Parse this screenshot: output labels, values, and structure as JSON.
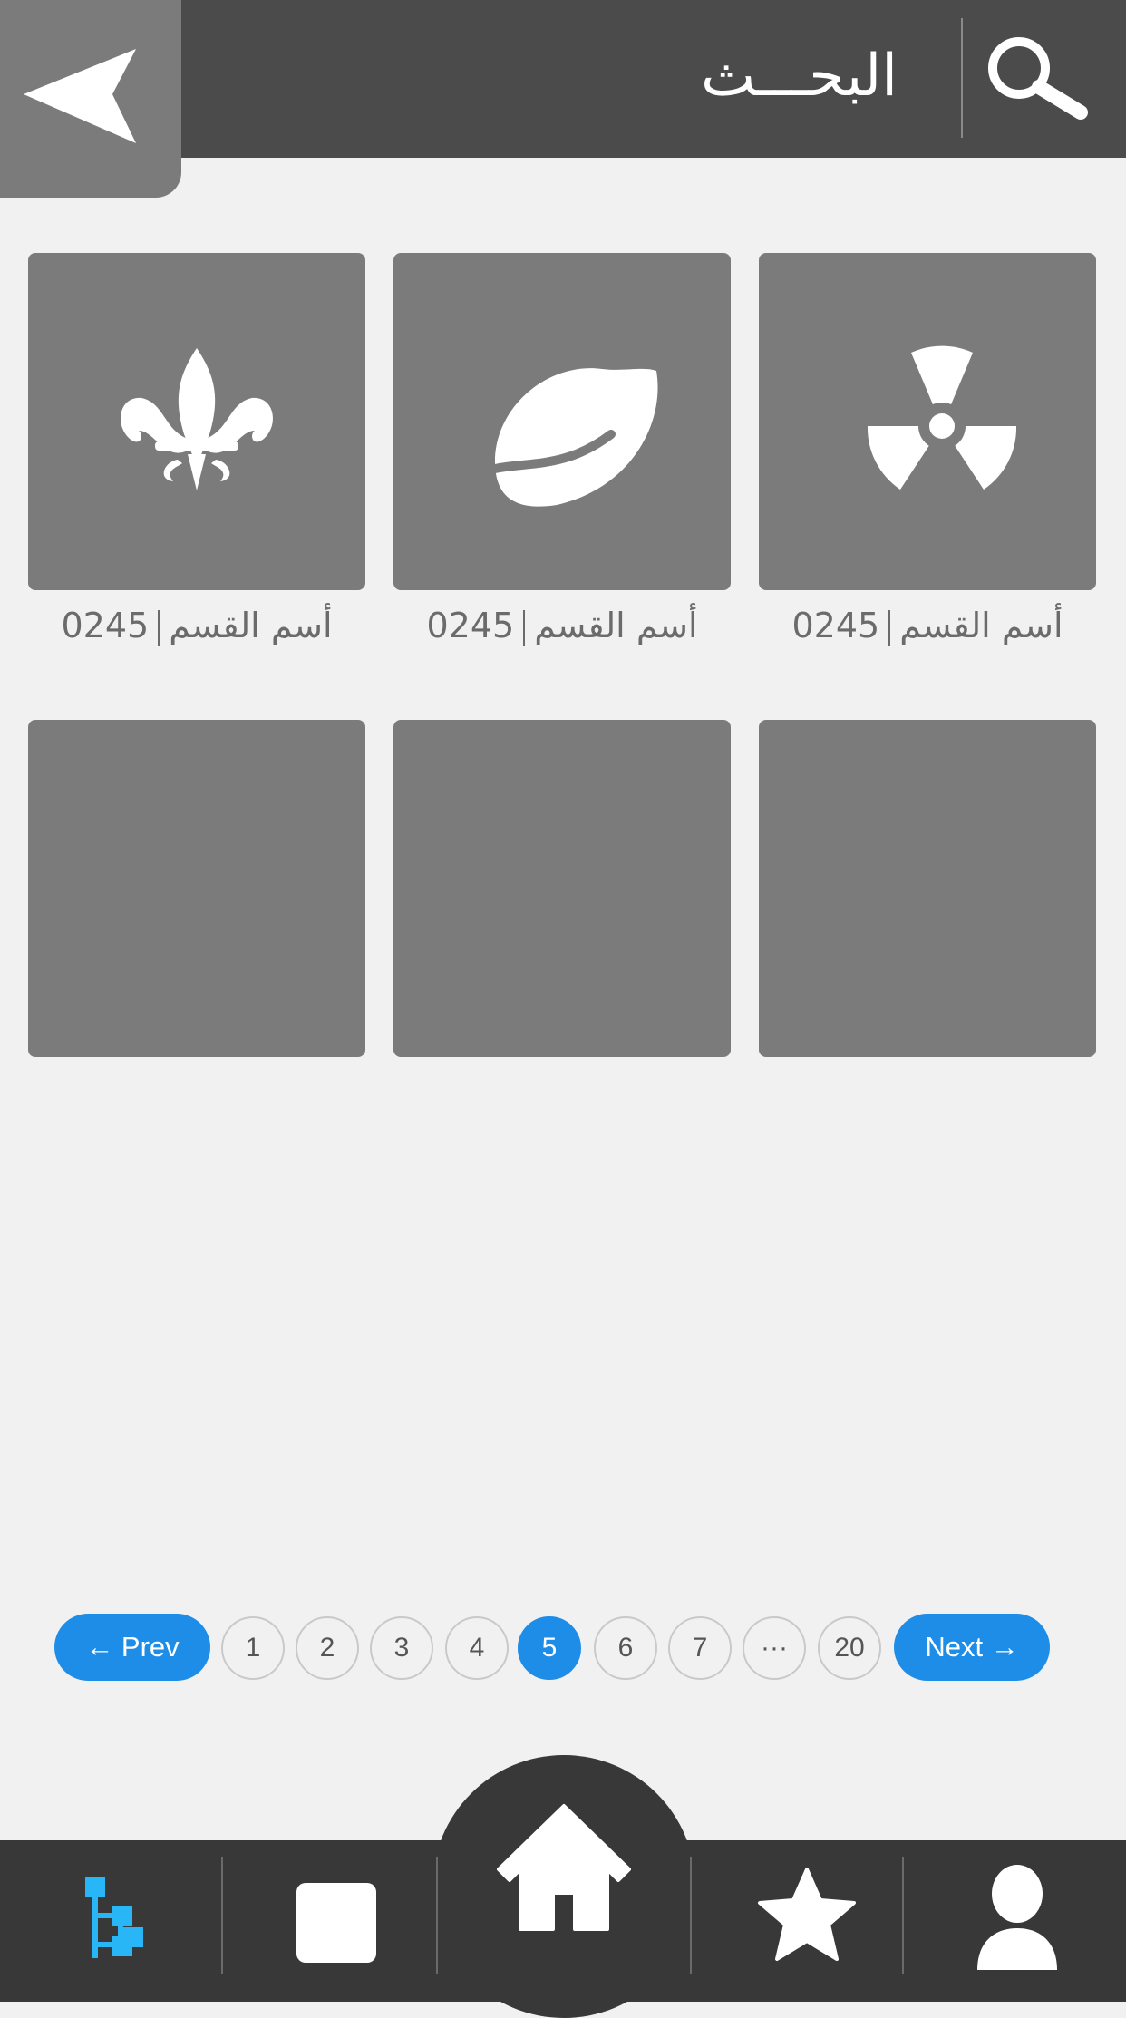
{
  "header": {
    "title": "البحـــث",
    "back_icon": "back-arrow-icon",
    "search_icon": "search-icon"
  },
  "tiles": [
    {
      "name": "أسم القسم",
      "count": "0245",
      "icon": "radiation-icon"
    },
    {
      "name": "أسم القسم",
      "count": "0245",
      "icon": "leaf-icon"
    },
    {
      "name": "أسم القسم",
      "count": "0245",
      "icon": "fleur-de-lis-icon"
    }
  ],
  "pagination": {
    "prev_label": "← Prev",
    "next_label": "Next →",
    "pages": [
      "1",
      "2",
      "3",
      "4",
      "5",
      "6",
      "7",
      "···",
      "20"
    ],
    "current": "5"
  },
  "bottom_nav": {
    "items": [
      "tree-icon",
      "square-icon",
      "home-icon",
      "star-icon",
      "user-icon"
    ],
    "active": "tree-icon"
  },
  "colors": {
    "header_bg": "#4b4b4b",
    "tile_bg": "#7b7b7b",
    "accent": "#1e8de8",
    "nav_bg": "#383838",
    "active_nav_icon": "#29b6f6"
  }
}
